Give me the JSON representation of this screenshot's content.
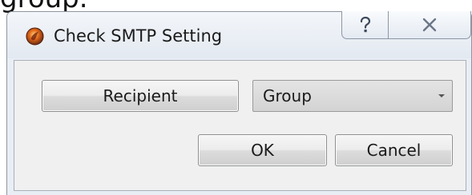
{
  "background_text": "group.",
  "window": {
    "title": "Check SMTP Setting",
    "app_icon": "flame-app-icon",
    "controls": {
      "help_icon": "help-icon",
      "close_icon": "close-icon"
    }
  },
  "dialog": {
    "recipient_label": "Recipient",
    "group_select": {
      "value": "Group",
      "icon": "chevron-down-icon"
    },
    "ok_label": "OK",
    "cancel_label": "Cancel"
  },
  "colors": {
    "titlebar": "#e3e9f1",
    "client": "#f0f0f0",
    "button": "#e6e6e6",
    "combo": "#d8d8d8"
  }
}
